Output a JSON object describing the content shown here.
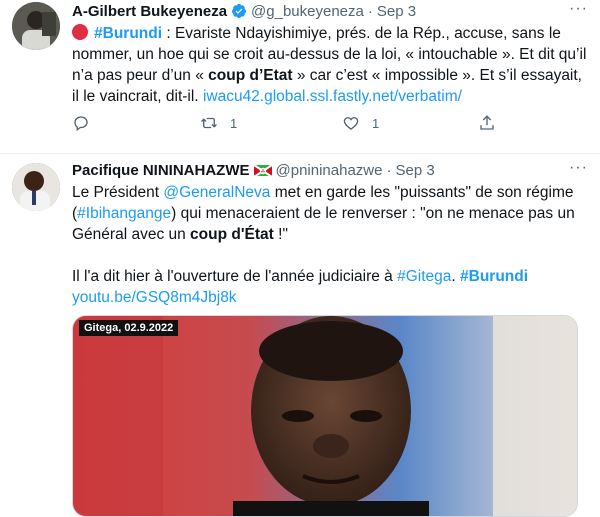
{
  "tweets": [
    {
      "name": "A-Gilbert Bukeyeneza",
      "handle": "@g_bukeyeneza",
      "date": "Sep 3",
      "hashtag": "#Burundi",
      "text_1": " : Evariste Ndayishimiye, prés. de la Rép., accuse, sans le nommer, un hoe qui se croit au-dessus de la loi, « intouchable ». Et dit qu’il n’a pas peur d’un « ",
      "bold_1": "coup d’Etat",
      "text_2": " » car c’est « impossible ». Et s’il essayait, il le vaincrait, dit-il. ",
      "link": "iwacu42.global.ssl.fastly.net/verbatim/",
      "reply_count": "",
      "retweet_count": "1",
      "like_count": "1"
    },
    {
      "name": "Pacifique NININAHAZWE",
      "handle": "@pnininahazwe",
      "date": "Sep 3",
      "p1_a": "Le Président ",
      "p1_mention": "@GeneralNeva",
      "p1_b": " met en garde les \"puissants\" de son régime (",
      "p1_tag": "#Ibihangange",
      "p1_c": ") qui menaceraient de le renverser : \"on ne menace pas un Général avec un ",
      "p1_bold": "coup d'État",
      "p1_d": " !\"",
      "p2_a": "Il l'a dit hier à l'ouverture de l'année judiciaire à ",
      "p2_tag1": "#Gitega",
      "p2_b": ". ",
      "p2_tag2": "#Burundi",
      "p2_link": "youtu.be/GSQ8m4Jbj8k",
      "media_caption": "Gitega, 02.9.2022"
    }
  ],
  "colors": {
    "link": "#1d9bf0",
    "muted": "#536471",
    "verified": "#1d9bf0",
    "red_dot": "#dd2e44"
  }
}
